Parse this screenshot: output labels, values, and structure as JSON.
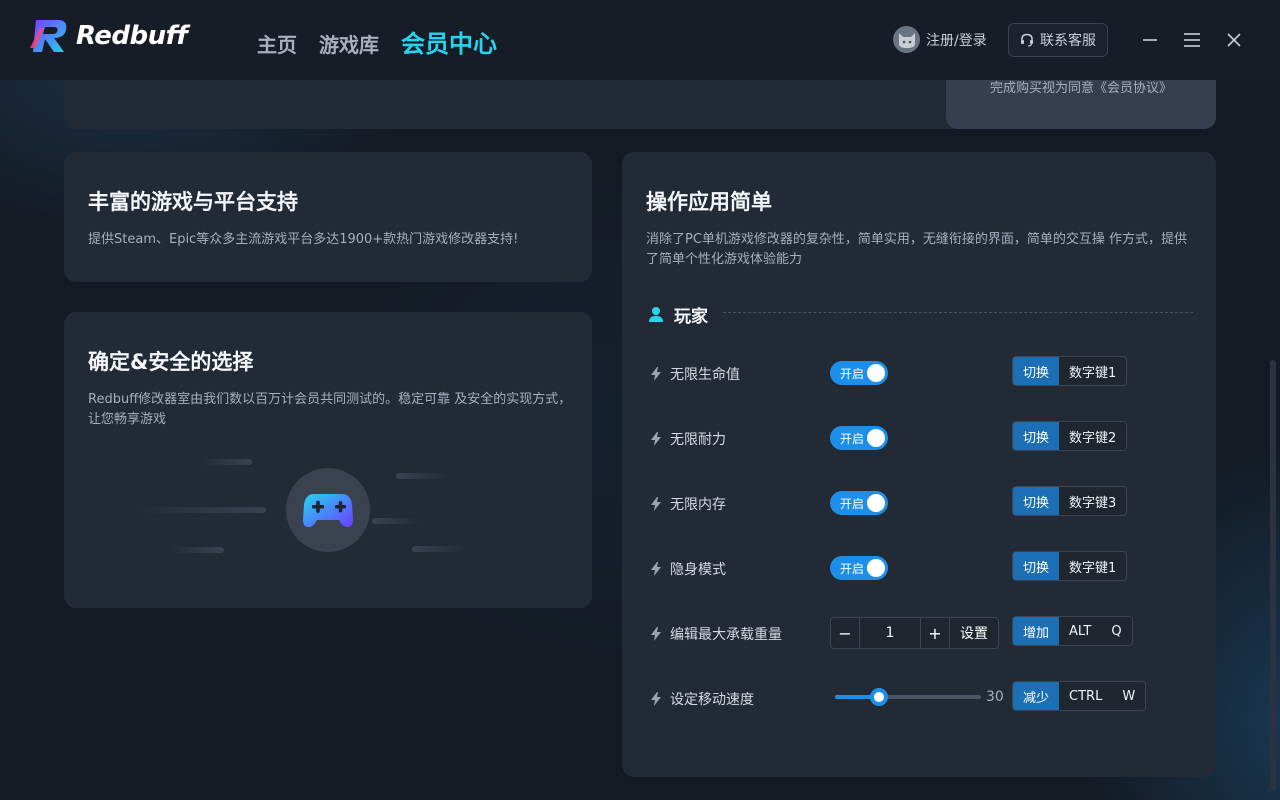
{
  "app": {
    "logo_text": "Redbuff"
  },
  "nav": {
    "items": [
      {
        "label": "主页",
        "active": false
      },
      {
        "label": "游戏库",
        "active": false
      },
      {
        "label": "会员中心",
        "active": true
      }
    ]
  },
  "header": {
    "login_label": "注册/登录",
    "service_label": "联系客服"
  },
  "top_card": {
    "agreement_text": "完成购买视为同意《会员协议》"
  },
  "cards": {
    "games": {
      "title": "丰富的游戏与平台支持",
      "desc": "提供Steam、Epic等众多主流游戏平台多达1900+款热门游戏修改器支持!"
    },
    "safety": {
      "title": "确定&安全的选择",
      "desc": "Redbuff修改器室由我们数以百万计会员共同测试的。稳定可靠 及安全的实现方式，让您畅享游戏"
    },
    "simple": {
      "title": "操作应用简单",
      "desc": "消除了PC单机游戏修改器的复杂性，简单实用，无缝衔接的界面，简单的交互操 作方式，提供了简单个性化游戏体验能力"
    }
  },
  "player": {
    "section_label": "玩家",
    "toggle_rows": [
      {
        "label": "无限生命值",
        "toggle": "开启",
        "action": "切换",
        "keys": [
          "数字键1"
        ]
      },
      {
        "label": "无限耐力",
        "toggle": "开启",
        "action": "切换",
        "keys": [
          "数字键2"
        ]
      },
      {
        "label": "无限内存",
        "toggle": "开启",
        "action": "切换",
        "keys": [
          "数字键3"
        ]
      },
      {
        "label": "隐身模式",
        "toggle": "开启",
        "action": "切换",
        "keys": [
          "数字键1"
        ]
      }
    ],
    "weight_row": {
      "label": "编辑最大承载重量",
      "minus": "−",
      "value": "1",
      "plus": "+",
      "set": "设置",
      "action": "增加",
      "keys": [
        "ALT",
        "Q"
      ]
    },
    "speed_row": {
      "label": "设定移动速度",
      "value": "30",
      "fill_fraction": 0.3,
      "action": "减少",
      "keys": [
        "CTRL",
        "W"
      ]
    }
  },
  "colors": {
    "accent": "#27d4f0",
    "toggle_blue": "#1e8fe8",
    "action_blue": "#1c6fb4",
    "card_bg": "#222a35",
    "page_bg": "#141a23"
  },
  "icons": {
    "logo": "redbuff-logo-icon",
    "user": "cat-avatar-icon",
    "headset": "headset-icon",
    "minimize": "minimize-icon",
    "menu": "menu-icon",
    "close": "close-icon",
    "gamepad": "gamepad-icon",
    "player": "user-icon",
    "bolt": "bolt-icon"
  }
}
